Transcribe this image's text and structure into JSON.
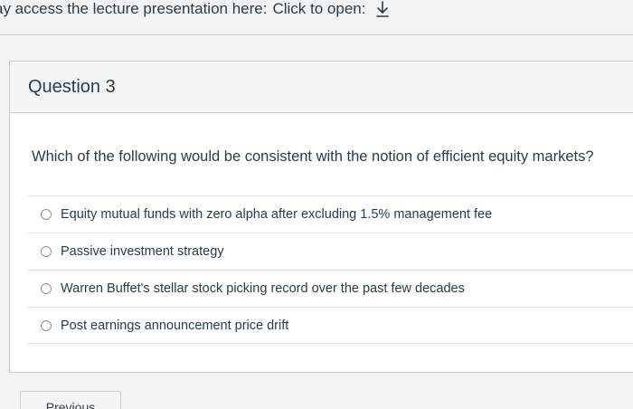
{
  "intro": {
    "text": "ay access the lecture presentation here:",
    "link_label": "Click to open:",
    "link_icon": "download-icon"
  },
  "question": {
    "title": "Question 3",
    "text": "Which of the following would be consistent with the notion of efficient equity markets?",
    "answers": [
      {
        "label": "Equity mutual funds with zero alpha after excluding 1.5% management fee",
        "selected": false
      },
      {
        "label": "Passive investment strategy",
        "selected": false
      },
      {
        "label": "Warren Buffet's stellar stock picking record over the past few decades",
        "selected": false
      },
      {
        "label": "Post earnings announcement price drift",
        "selected": false
      }
    ]
  },
  "nav": {
    "previous_label": "Previous"
  }
}
